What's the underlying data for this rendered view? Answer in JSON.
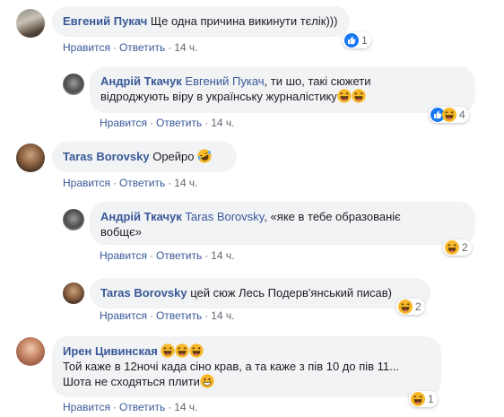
{
  "comments": [
    {
      "author": "Евгений Пукач",
      "text": "Ще одна причина викинути тєлік)))",
      "like_label": "Нравится",
      "reply_label": "Ответить",
      "time": "14 ч.",
      "reaction_count": "1",
      "reaction_icons": [
        "like-icon"
      ]
    },
    {
      "author": "Андрій Ткачук",
      "mention": "Евгений Пукач",
      "text_line1": ", ти шо, такі сюжети",
      "text_line2": "відроджують віру в українську журналістику",
      "like_label": "Нравится",
      "reply_label": "Ответить",
      "time": "14 ч.",
      "reaction_count": "4",
      "reaction_icons": [
        "like-icon",
        "haha-icon"
      ]
    },
    {
      "author": "Taras Borovsky",
      "text": "Орейро",
      "like_label": "Нравится",
      "reply_label": "Ответить",
      "time": "14 ч."
    },
    {
      "author": "Андрій Ткачук",
      "mention": "Taras Borovsky",
      "text_line1": ", «яке в тебе образованіє",
      "text_line2": "вобщє»",
      "like_label": "Нравится",
      "reply_label": "Ответить",
      "time": "14 ч.",
      "reaction_count": "2",
      "reaction_icons": [
        "haha-icon"
      ]
    },
    {
      "author": "Taras Borovsky",
      "text": "цей сюж Лесь Подерв'янський писав)",
      "like_label": "Нравится",
      "reply_label": "Ответить",
      "time": "14 ч.",
      "reaction_count": "2",
      "reaction_icons": [
        "haha-icon"
      ]
    },
    {
      "author": "Ирен Цивинская",
      "text_line1": "Той каже в 12ночі када сіно крав, а та каже з пів 10 до пів 11...",
      "text_line2": "Шота не сходяться плити",
      "like_label": "Нравится",
      "reply_label": "Ответить",
      "time": "14 ч.",
      "reaction_count": "1",
      "reaction_icons": [
        "haha-icon"
      ]
    }
  ],
  "colors": {
    "name": "#385898",
    "bubble": "#f2f3f5",
    "meta": "#606770",
    "like": "#1877f2",
    "haha": "#f7b928"
  }
}
